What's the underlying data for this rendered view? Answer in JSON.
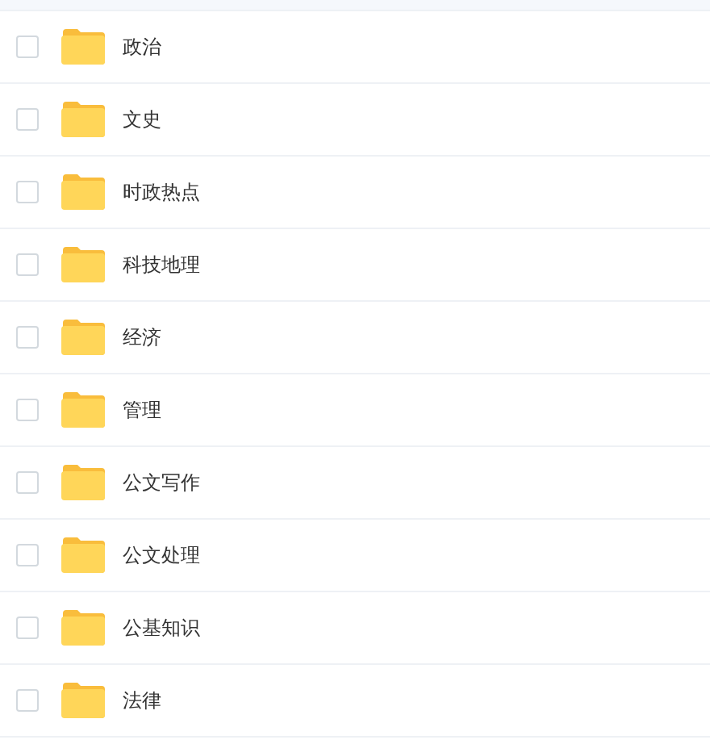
{
  "files": [
    {
      "name": "政治",
      "checked": false
    },
    {
      "name": "文史",
      "checked": false
    },
    {
      "name": "时政热点",
      "checked": false
    },
    {
      "name": "科技地理",
      "checked": false
    },
    {
      "name": "经济",
      "checked": false
    },
    {
      "name": "管理",
      "checked": false
    },
    {
      "name": "公文写作",
      "checked": false
    },
    {
      "name": "公文处理",
      "checked": false
    },
    {
      "name": "公基知识",
      "checked": false
    },
    {
      "name": "法律",
      "checked": false
    }
  ]
}
